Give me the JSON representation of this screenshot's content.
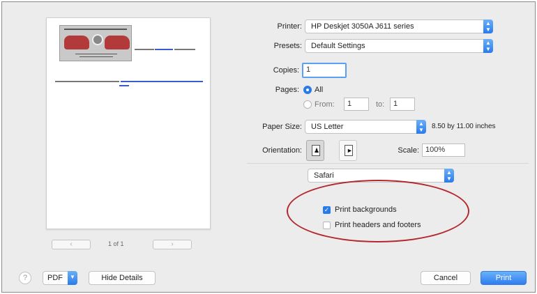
{
  "preview": {
    "page_indicator": "1 of 1",
    "prev_label": "‹",
    "next_label": "›"
  },
  "settings": {
    "printer_label": "Printer:",
    "printer_value": "HP Deskjet 3050A J611 series",
    "presets_label": "Presets:",
    "presets_value": "Default Settings",
    "copies_label": "Copies:",
    "copies_value": "1",
    "pages_label": "Pages:",
    "pages_all_label": "All",
    "pages_from_label": "From:",
    "pages_from_value": "1",
    "pages_to_label": "to:",
    "pages_to_value": "1",
    "paper_size_label": "Paper Size:",
    "paper_size_value": "US Letter",
    "paper_size_dims": "8.50 by 11.00 inches",
    "orientation_label": "Orientation:",
    "scale_label": "Scale:",
    "scale_value": "100%",
    "app_section_value": "Safari",
    "print_backgrounds_label": "Print backgrounds",
    "print_backgrounds_checked": true,
    "print_headers_label": "Print headers and footers",
    "print_headers_checked": false
  },
  "bottom_bar": {
    "help_label": "?",
    "pdf_label": "PDF",
    "hide_details_label": "Hide Details",
    "cancel_label": "Cancel",
    "print_label": "Print"
  },
  "colors": {
    "accent_blue": "#2a7bea",
    "annotation_red": "#b3282d"
  }
}
